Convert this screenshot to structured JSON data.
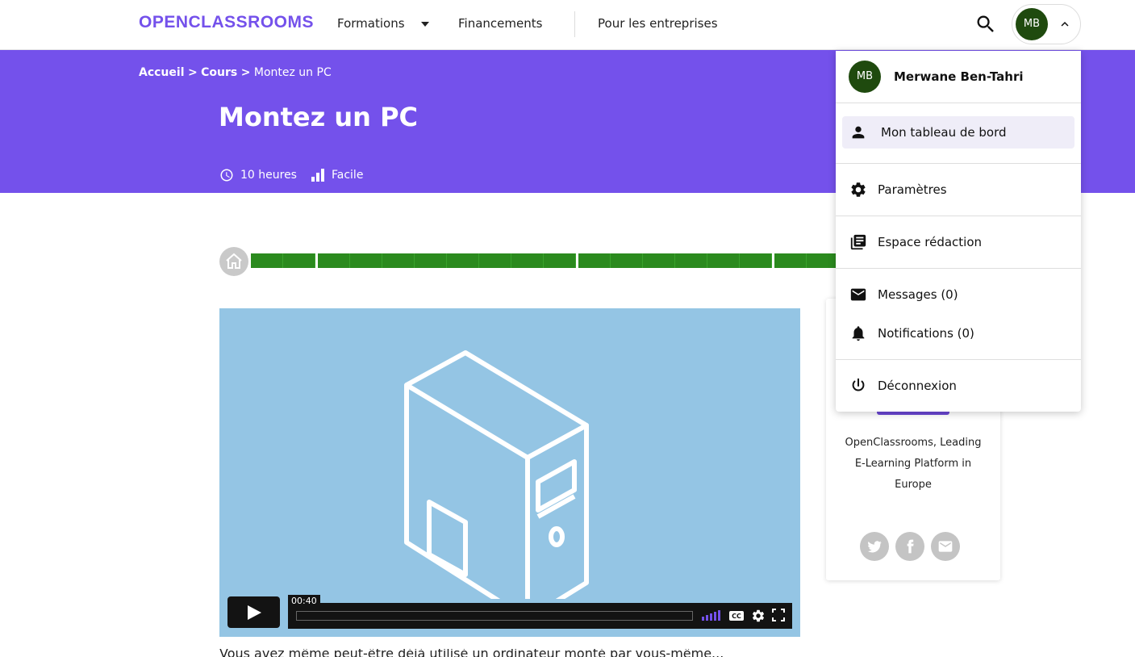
{
  "header": {
    "logo": "OPENCLASSROOMS",
    "nav": {
      "formations": "Formations",
      "financements": "Financements",
      "entreprises": "Pour les entreprises"
    },
    "user_initials": "MB"
  },
  "hero": {
    "breadcrumb": {
      "home": "Accueil",
      "sep1": ">",
      "courses": "Cours",
      "sep2": ">",
      "current": "Montez un PC"
    },
    "title": "Montez un PC",
    "duration": "10 heures",
    "level": "Facile",
    "background_color": "#7451eb"
  },
  "progress": {
    "groups": [
      2,
      8,
      6,
      4
    ],
    "color": "#2b8a1e"
  },
  "video": {
    "timecode": "00:40",
    "background_color": "#94c5e4"
  },
  "author_card": {
    "description": "OpenClassrooms, Leading E-Learning Platform in Europe",
    "social": [
      "twitter-icon",
      "facebook-icon",
      "mail-icon"
    ]
  },
  "lesson": {
    "text": "Vous avez même peut-être déjà utilisé un ordinateur monté par vous-même..."
  },
  "dropdown": {
    "initials": "MB",
    "name": "Merwane Ben-Tahri",
    "items": {
      "dashboard": "Mon tableau de bord",
      "settings": "Paramètres",
      "editorial": "Espace rédaction",
      "messages": "Messages (0)",
      "notifications": "Notifications (0)",
      "logout": "Déconnexion"
    }
  }
}
